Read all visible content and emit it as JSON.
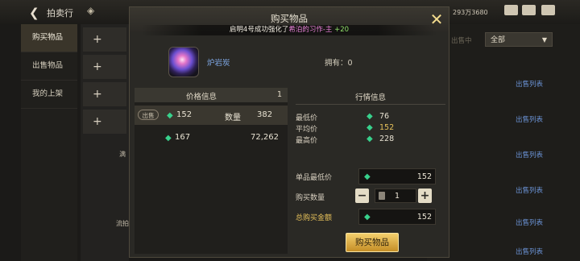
{
  "background": {
    "title": "拍卖行",
    "currency_text": "293万3680",
    "sidebar": [
      {
        "label": "购买物品",
        "active": true
      },
      {
        "label": "出售物品",
        "active": false
      },
      {
        "label": "我的上架",
        "active": false
      }
    ],
    "list_rows": [
      "+",
      "+",
      "+",
      "+"
    ],
    "status_label": "出售中",
    "filter_value": "全部",
    "sell_list_labels": [
      "出售列表",
      "出售列表",
      "出售列表",
      "出售列表",
      "出售列表",
      "出售列表"
    ],
    "list_small_labels": [
      "满",
      "流拍"
    ]
  },
  "modal": {
    "title": "购买物品",
    "notice": {
      "prefix": "启明4号成功强化了",
      "item": "希泊的习作-主",
      "bonus": "+20"
    },
    "item": {
      "name": "炉岩炭",
      "owned_label": "拥有：",
      "owned_value": "0"
    },
    "price_panel": {
      "title": "价格信息",
      "count": "1",
      "rows": [
        {
          "badge": "出售",
          "price": "152",
          "qty_label": "数量",
          "qty": "382"
        },
        {
          "badge": "",
          "price": "167",
          "qty_label": "",
          "qty": "72,262"
        }
      ]
    },
    "market": {
      "title": "行情信息",
      "rows": [
        {
          "label": "最低价",
          "value": "76",
          "color": "#e8e2d2"
        },
        {
          "label": "平均价",
          "value": "152",
          "color": "#e6c15a"
        },
        {
          "label": "最高价",
          "value": "228",
          "color": "#e8e2d2"
        }
      ]
    },
    "form": {
      "unit_price_label": "单品最低价",
      "unit_price": "152",
      "qty_label": "购买数量",
      "qty": "1",
      "total_label": "总购买金额",
      "total": "152"
    },
    "buy_label": "购买物品"
  },
  "colors": {
    "accent_gold": "#e6c15a",
    "gem_green": "#38d18c",
    "link_blue": "#6b93d6"
  }
}
